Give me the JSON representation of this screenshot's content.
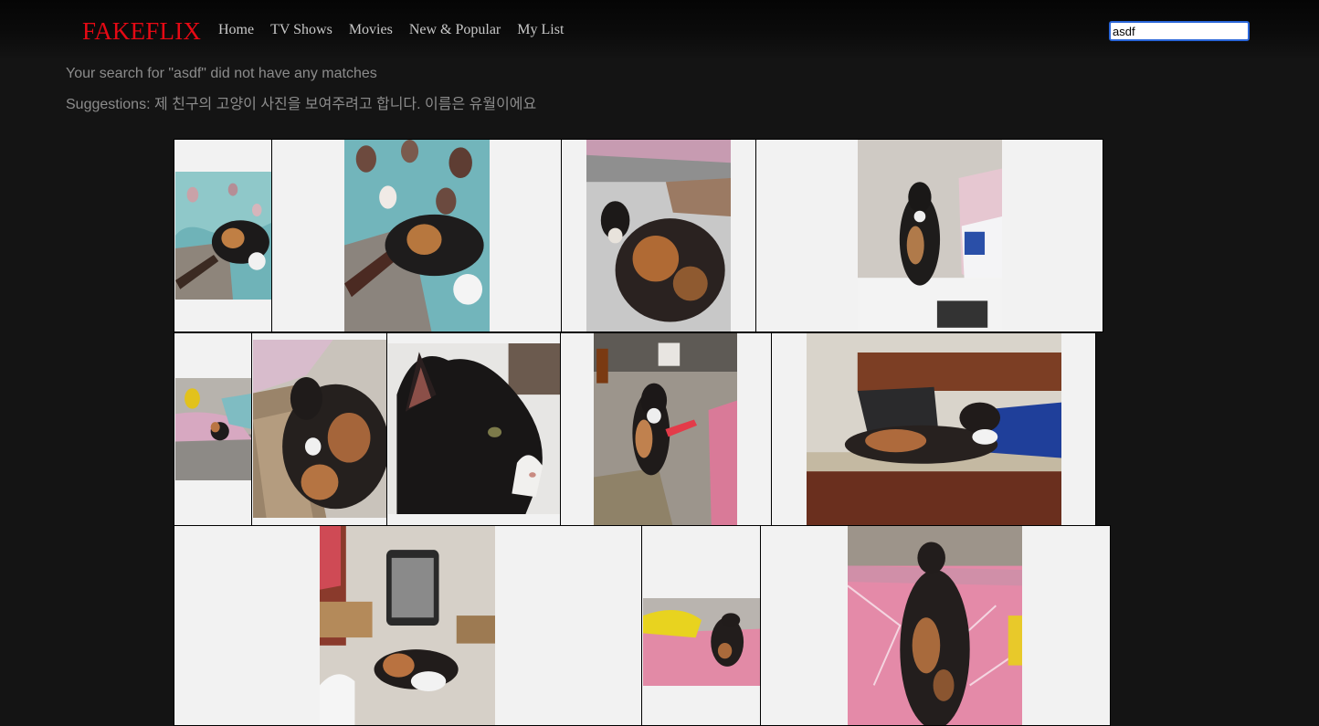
{
  "header": {
    "logo": "FAKEFLIX",
    "nav": [
      "Home",
      "TV Shows",
      "Movies",
      "New & Popular",
      "My List"
    ],
    "search_value": "asdf"
  },
  "results": {
    "no_match": "Your search for \"asdf\" did not have any matches",
    "suggestions": "Suggestions: 제 친구의 고양이 사진을 보여주려고 합니다. 이름은 유월이에요"
  },
  "gallery": {
    "photos": [
      "calico cat sleeping on quilt",
      "calico cat lying on blanket and couch",
      "calico cat loaf on cushion",
      "calico cat sitting on fridge",
      "calico cat on bed near toy",
      "calico cat curled on scratcher",
      "calico cat face close-up",
      "calico cat standing near desk",
      "calico cat lying on wooden bench",
      "calico cat lying near heater",
      "calico cat beside yellow toy",
      "calico cat on pink blanket from behind"
    ]
  },
  "colors": {
    "background": "#141414",
    "brand": "#e50914",
    "nav_text": "#c8c8c8",
    "message_text": "#8c8c8c",
    "tile_background": "#f2f2f2"
  }
}
